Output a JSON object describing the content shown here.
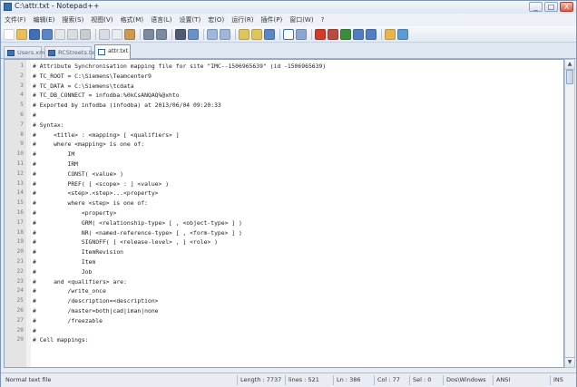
{
  "window": {
    "title": "C:\\attr.txt - Notepad++",
    "buttons": [
      "_",
      "□",
      "X"
    ]
  },
  "menu": [
    "文件(F)",
    "编辑(E)",
    "搜索(S)",
    "视图(V)",
    "格式(M)",
    "语言(L)",
    "设置(T)",
    "宏(O)",
    "运行(R)",
    "插件(P)",
    "窗口(W)",
    "?"
  ],
  "toolbar_icons": [
    "new-file-icon",
    "open-file-icon",
    "save-icon",
    "save-all-icon",
    "close-icon",
    "close-all-icon",
    "print-icon",
    "cut-icon",
    "copy-icon",
    "paste-icon",
    "undo-icon",
    "redo-icon",
    "find-icon",
    "replace-icon",
    "zoom-in-icon",
    "zoom-out-icon",
    "sync-v-icon",
    "sync-h-icon",
    "word-wrap-icon",
    "show-all-chars-icon",
    "indent-guide-icon",
    "record-macro-icon",
    "stop-macro-icon",
    "play-macro-icon",
    "play-macro-multi-icon",
    "save-macro-icon",
    "run-icon",
    "spellcheck-icon"
  ],
  "tabs": [
    {
      "label": "Users.xml",
      "active": false
    },
    {
      "label": "RCStreets.txt",
      "active": false
    },
    {
      "label": "attr.txt",
      "active": true
    }
  ],
  "editor": {
    "lines": [
      "# Attribute Synchronisation mapping file for site \"IMC--1506965639\" (id -1506965639)",
      "# TC_ROOT = C:\\Siemens\\Teamcenter9",
      "# TC_DATA = C:\\Siemens\\tcdata",
      "# TC_DB_CONNECT = infodba:%0kCsANQAQ%@xhto",
      "# Exported by infodba (infodba) at 2013/06/04 09:20:33",
      "#",
      "# Syntax:",
      "#     <title> : <mapping> [ <qualifiers> ]",
      "#     where <mapping> is one of:",
      "#         IM",
      "#         IRM",
      "#         CONST( <value> )",
      "#         PREF( [ <scope> : ] <value> )",
      "#         <step>.<step>...<property>",
      "#         where <step> is one of:",
      "#             <property>",
      "#             GRM( <relationship-type> [ , <object-type> ] )",
      "#             NR( <named-reference-type> [ , <form-type> ] )",
      "#             SIGNOFF( [ <release-level> , ] <role> )",
      "#             ItemRevision",
      "#             Item",
      "#             Job",
      "#     and <qualifiers> are:",
      "#         /write_once",
      "#         /description=<description>",
      "#         /master=both|cad|iman|none",
      "#         /freezable",
      "#",
      "# Cell mappings:"
    ]
  },
  "status": {
    "filetype": "Normal text file",
    "length": "Length : 7737",
    "lines": "lines : 521",
    "ln": "Ln : 386",
    "col": "Col : 77",
    "sel": "Sel : 0",
    "eol": "Dos\\Windows",
    "encoding": "ANSI",
    "mode": "INS"
  }
}
